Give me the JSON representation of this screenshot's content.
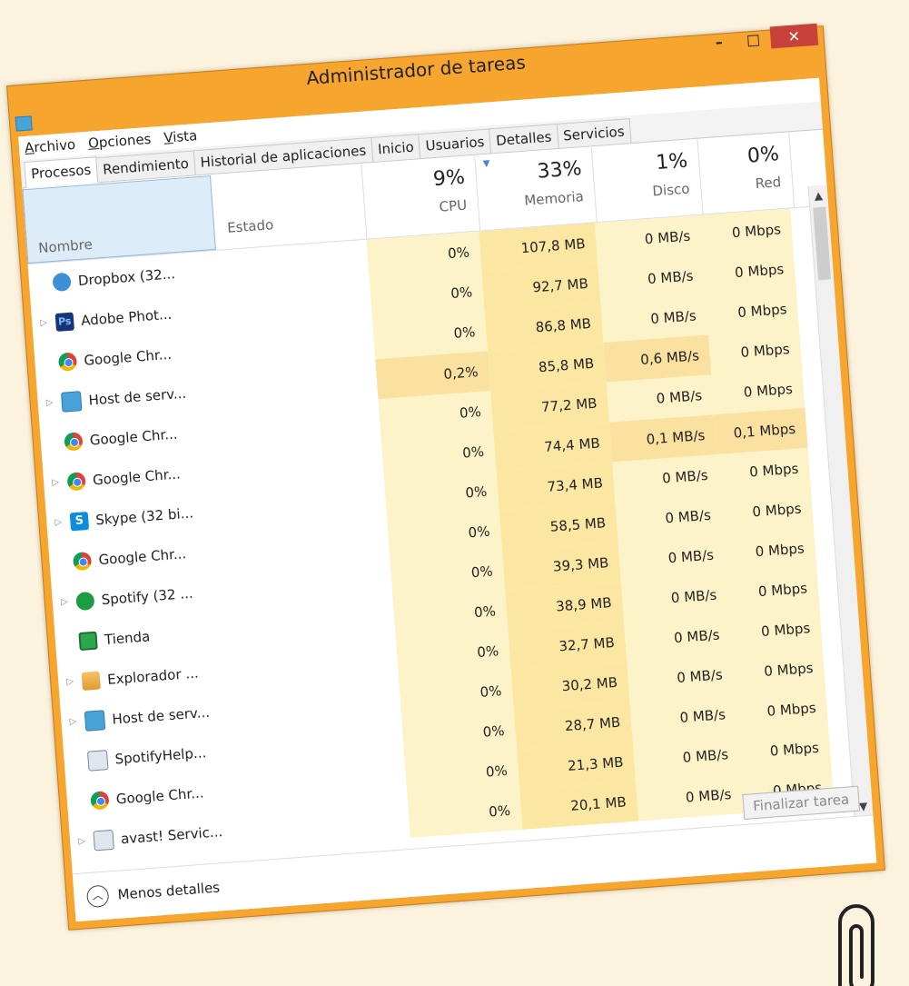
{
  "window": {
    "title": "Administrador de tareas",
    "minimize": "–",
    "maximize": "□",
    "close": "✕"
  },
  "menu": [
    "Archivo",
    "Opciones",
    "Vista"
  ],
  "tabs": [
    "Procesos",
    "Rendimiento",
    "Historial de aplicaciones",
    "Inicio",
    "Usuarios",
    "Detalles",
    "Servicios"
  ],
  "columns": {
    "name": "Nombre",
    "status": "Estado",
    "cpu": {
      "pct": "9%",
      "label": "CPU"
    },
    "memory": {
      "pct": "33%",
      "label": "Memoria"
    },
    "disk": {
      "pct": "1%",
      "label": "Disco"
    },
    "network": {
      "pct": "0%",
      "label": "Red"
    }
  },
  "rows": [
    {
      "name": "Dropbox (32...",
      "icon": "dropbox-icon",
      "expand": false,
      "cpu": "0%",
      "mem": "107,8 MB",
      "disk": "0 MB/s",
      "net": "0 Mbps"
    },
    {
      "name": "Adobe Phot...",
      "icon": "photoshop-icon",
      "expand": true,
      "cpu": "0%",
      "mem": "92,7 MB",
      "disk": "0 MB/s",
      "net": "0 Mbps"
    },
    {
      "name": "Google Chr...",
      "icon": "chrome-icon",
      "expand": false,
      "cpu": "0%",
      "mem": "86,8 MB",
      "disk": "0 MB/s",
      "net": "0 Mbps"
    },
    {
      "name": "Host de serv...",
      "icon": "host-service-icon",
      "expand": true,
      "cpu": "0,2%",
      "mem": "85,8 MB",
      "disk": "0,6 MB/s",
      "net": "0 Mbps"
    },
    {
      "name": "Google Chr...",
      "icon": "chrome-icon",
      "expand": false,
      "cpu": "0%",
      "mem": "77,2 MB",
      "disk": "0 MB/s",
      "net": "0 Mbps"
    },
    {
      "name": "Google Chr...",
      "icon": "chrome-icon",
      "expand": true,
      "cpu": "0%",
      "mem": "74,4 MB",
      "disk": "0,1 MB/s",
      "net": "0,1 Mbps"
    },
    {
      "name": "Skype (32 bi...",
      "icon": "skype-icon",
      "expand": true,
      "cpu": "0%",
      "mem": "73,4 MB",
      "disk": "0 MB/s",
      "net": "0 Mbps"
    },
    {
      "name": "Google Chr...",
      "icon": "chrome-icon",
      "expand": false,
      "cpu": "0%",
      "mem": "58,5 MB",
      "disk": "0 MB/s",
      "net": "0 Mbps"
    },
    {
      "name": "Spotify (32 ...",
      "icon": "spotify-icon",
      "expand": true,
      "cpu": "0%",
      "mem": "39,3 MB",
      "disk": "0 MB/s",
      "net": "0 Mbps"
    },
    {
      "name": "Tienda",
      "icon": "store-icon",
      "expand": false,
      "cpu": "0%",
      "mem": "38,9 MB",
      "disk": "0 MB/s",
      "net": "0 Mbps"
    },
    {
      "name": "Explorador ...",
      "icon": "explorer-icon",
      "expand": true,
      "cpu": "0%",
      "mem": "32,7 MB",
      "disk": "0 MB/s",
      "net": "0 Mbps"
    },
    {
      "name": "Host de serv...",
      "icon": "host-service-icon",
      "expand": true,
      "cpu": "0%",
      "mem": "30,2 MB",
      "disk": "0 MB/s",
      "net": "0 Mbps"
    },
    {
      "name": "SpotifyHelp...",
      "icon": "generic-app-icon",
      "expand": false,
      "cpu": "0%",
      "mem": "28,7 MB",
      "disk": "0 MB/s",
      "net": "0 Mbps"
    },
    {
      "name": "Google Chr...",
      "icon": "chrome-icon",
      "expand": false,
      "cpu": "0%",
      "mem": "21,3 MB",
      "disk": "0 MB/s",
      "net": "0 Mbps"
    },
    {
      "name": "avast! Servic...",
      "icon": "generic-app-icon",
      "expand": true,
      "cpu": "0%",
      "mem": "20,1 MB",
      "disk": "0 MB/s",
      "net": "0 Mbps"
    }
  ],
  "footer": {
    "less_details": "Menos detalles",
    "end_task": "Finalizar tarea"
  }
}
